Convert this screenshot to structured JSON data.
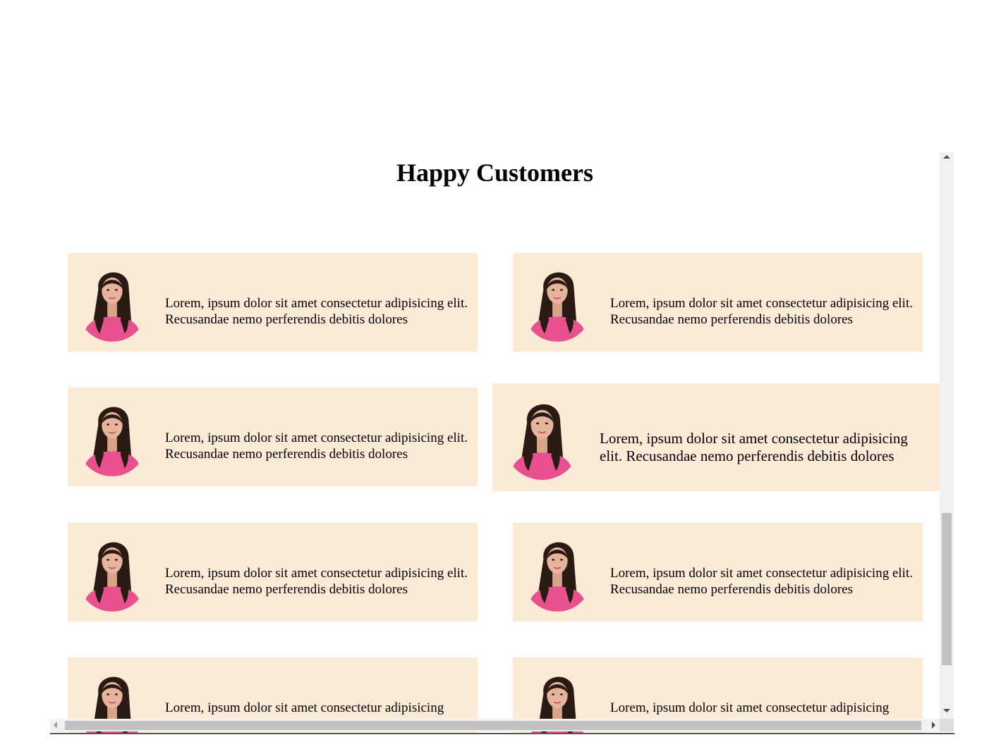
{
  "page": {
    "title": "Happy Customers"
  },
  "testimonials": [
    {
      "text": "Lorem, ipsum dolor sit amet consectetur adipisicing elit. Recusandae nemo perferendis debitis dolores",
      "avatar": "customer-portrait"
    },
    {
      "text": "Lorem, ipsum dolor sit amet consectetur adipisicing elit. Recusandae nemo perferendis debitis dolores",
      "avatar": "customer-portrait"
    },
    {
      "text": "Lorem, ipsum dolor sit amet consectetur adipisicing elit. Recusandae nemo perferendis debitis dolores",
      "avatar": "customer-portrait"
    },
    {
      "text": "Lorem, ipsum dolor sit amet consectetur adipisicing elit. Recusandae nemo perferendis debitis dolores",
      "avatar": "customer-portrait",
      "state": "hovered"
    },
    {
      "text": "Lorem, ipsum dolor sit amet consectetur adipisicing elit. Recusandae nemo perferendis debitis dolores",
      "avatar": "customer-portrait"
    },
    {
      "text": "Lorem, ipsum dolor sit amet consectetur adipisicing elit. Recusandae nemo perferendis debitis dolores",
      "avatar": "customer-portrait"
    },
    {
      "text": "Lorem, ipsum dolor sit amet consectetur adipisicing",
      "avatar": "customer-portrait"
    },
    {
      "text": "Lorem, ipsum dolor sit amet consectetur adipisicing",
      "avatar": "customer-portrait"
    }
  ],
  "colors": {
    "card_background": "#fbead6",
    "shirt": "#e8508e",
    "hair": "#2a1a14",
    "skin": "#e6b49a"
  }
}
